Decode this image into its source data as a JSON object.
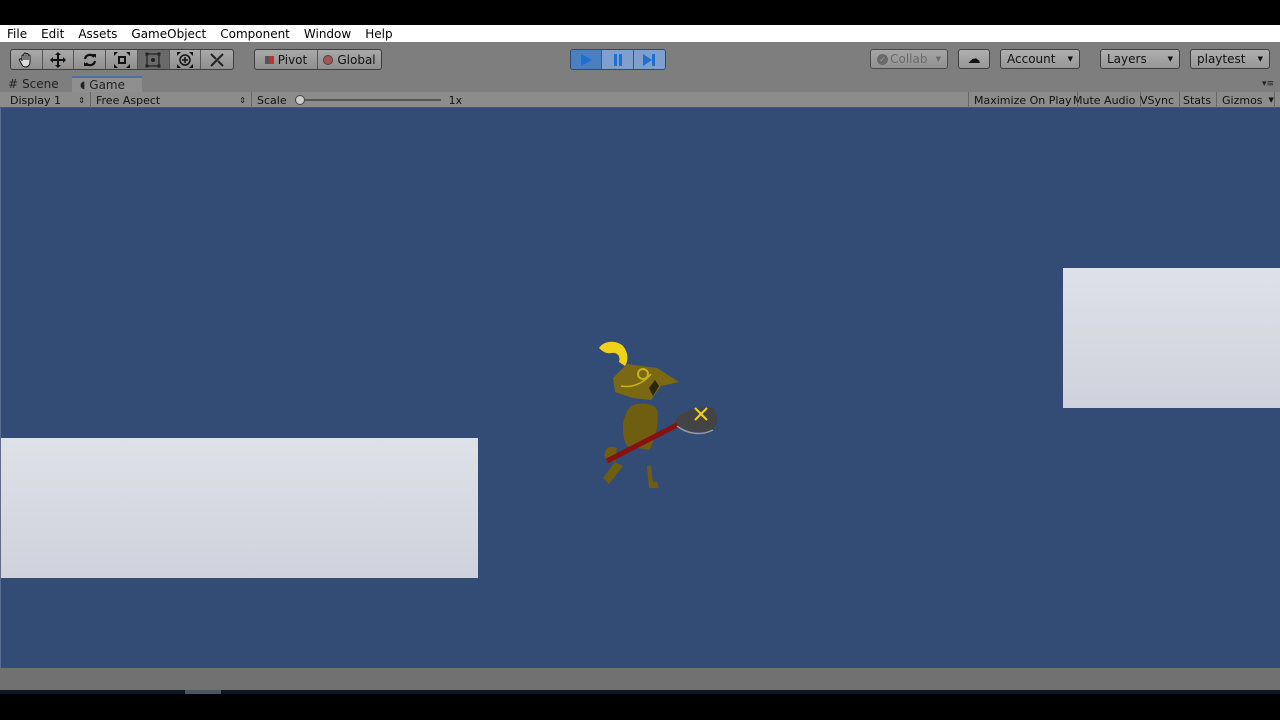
{
  "menu": [
    "File",
    "Edit",
    "Assets",
    "GameObject",
    "Component",
    "Window",
    "Help"
  ],
  "toolbar": {
    "tools": [
      "hand",
      "move",
      "rotate",
      "scale",
      "rect",
      "transform",
      "custom"
    ],
    "active_tool": "rect",
    "pivot": "Pivot",
    "global": "Global",
    "play_controls": [
      "play",
      "pause",
      "step"
    ],
    "play_active": true,
    "collab": "Collab",
    "account": "Account",
    "layers": "Layers",
    "layout": "playtest"
  },
  "tabs": [
    {
      "label": "Scene",
      "icon": "grid-icon"
    },
    {
      "label": "Game",
      "icon": "pacman-icon",
      "active": true
    }
  ],
  "game_toolbar": {
    "display": "Display 1",
    "aspect": "Free Aspect",
    "scale_label": "Scale",
    "scale_value": "1x",
    "scale_fraction": 0,
    "maximize": "Maximize On Play",
    "mute": "Mute Audio",
    "vsync": "VSync",
    "stats": "Stats",
    "gizmos": "Gizmos"
  },
  "colors": {
    "background": "#324c75",
    "platform": "#d6d9e1",
    "play_accent": "#3c8bd9"
  }
}
